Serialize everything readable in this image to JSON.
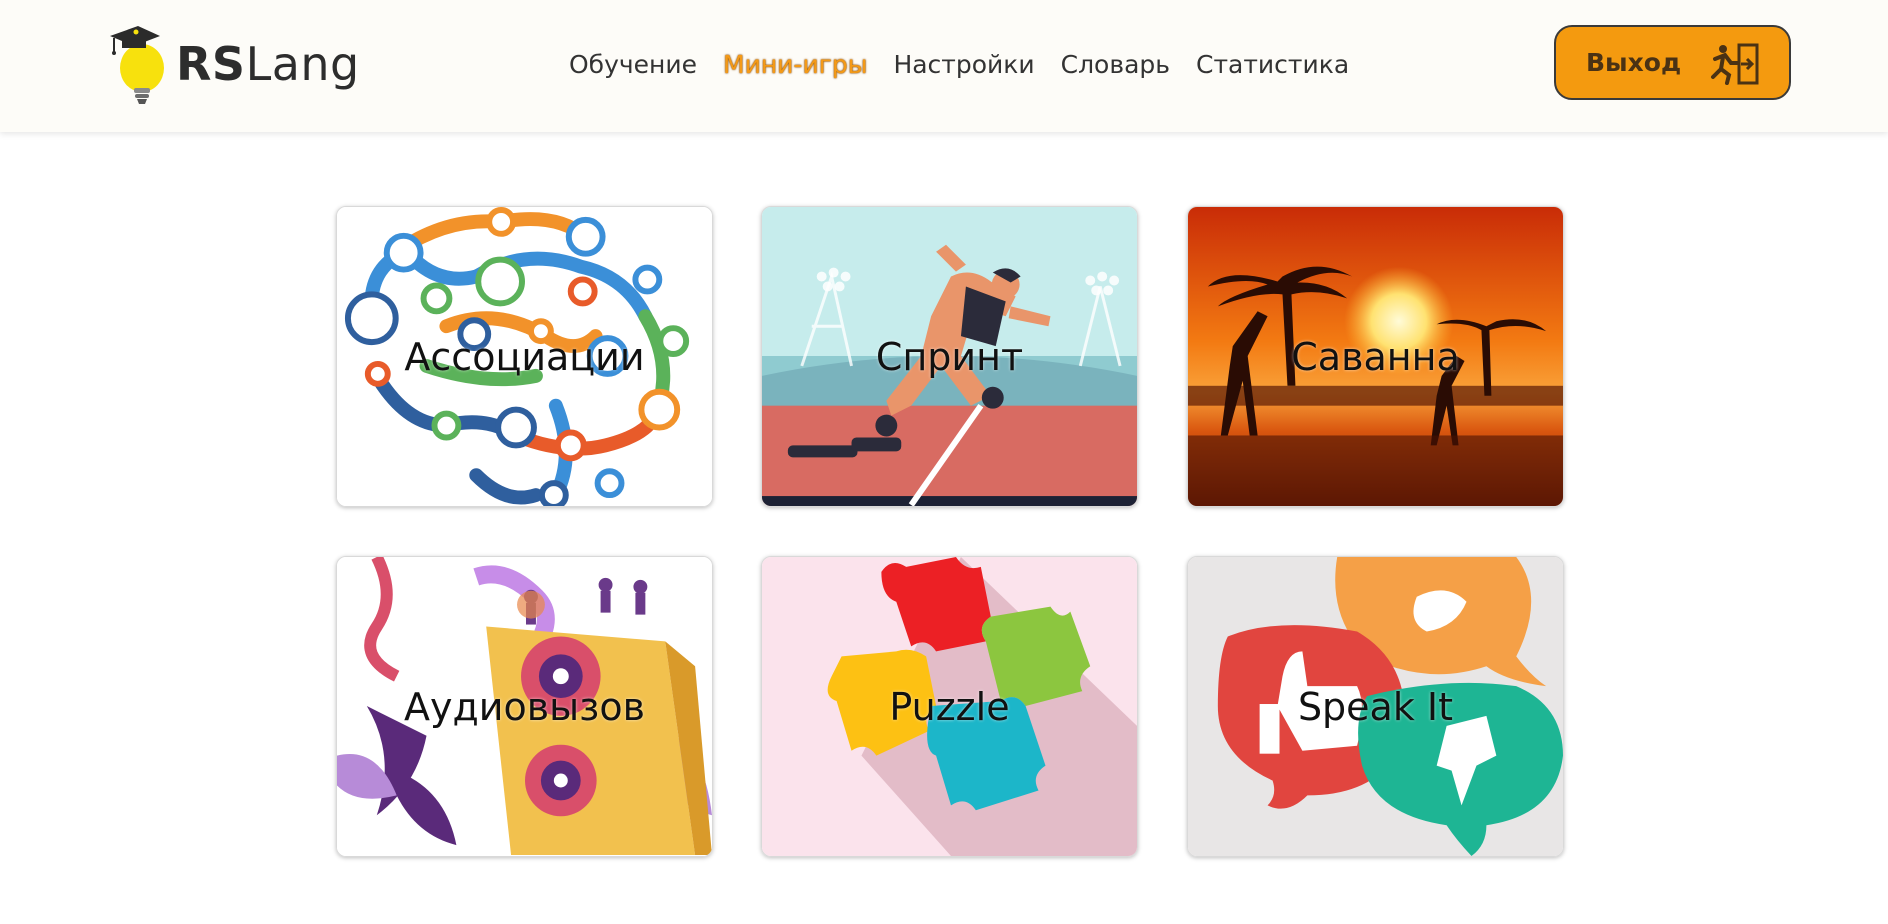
{
  "header": {
    "logo": {
      "text_bold": "RS",
      "text_light": "Lang",
      "icon": "lightbulb-graduation-cap-icon"
    },
    "nav": [
      {
        "label": "Обучение",
        "active": false
      },
      {
        "label": "Мини-игры",
        "active": true
      },
      {
        "label": "Настройки",
        "active": false
      },
      {
        "label": "Словарь",
        "active": false
      },
      {
        "label": "Статистика",
        "active": false
      }
    ],
    "exit_button": {
      "label": "Выход",
      "icon": "running-exit-icon"
    }
  },
  "games": [
    {
      "title": "Ассоциации",
      "image": "brain-network-icon"
    },
    {
      "title": "Спринт",
      "image": "sprinter-stadium-icon"
    },
    {
      "title": "Саванна",
      "image": "savanna-sunset-icon"
    },
    {
      "title": "Аудиовызов",
      "image": "music-speaker-icon"
    },
    {
      "title": "Puzzle",
      "image": "puzzle-pieces-icon"
    },
    {
      "title": "Speak It",
      "image": "speech-bubbles-icon"
    }
  ],
  "colors": {
    "accent": "#f49a0f",
    "header_bg": "#fdfcf8",
    "text": "#333333"
  }
}
